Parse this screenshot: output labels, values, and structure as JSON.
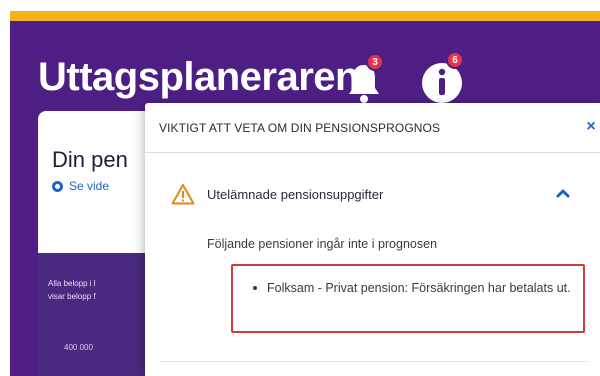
{
  "header": {
    "title": "Uttagsplaneraren",
    "notifications_count": "3",
    "info_count": "6"
  },
  "background_card": {
    "title": "Din pen",
    "link_label": "Se vide",
    "sub_text_line1": "Alla belopp i l",
    "sub_text_line2": "visar belopp f",
    "sub_amount": "400 000"
  },
  "popover": {
    "title": "VIKTIGT ATT VETA OM DIN PENSIONSPROGNOS",
    "close_label": "×",
    "accordion": {
      "label": "Utelämnade pensionsuppgifter",
      "expanded": true,
      "intro": "Följande pensioner ingår inte i prognosen",
      "items": [
        "Folksam - Privat pension: Försäkringen har betalats ut."
      ]
    }
  },
  "colors": {
    "brand_purple": "#4d1f84",
    "accent_yellow": "#f5b41e",
    "badge_red": "#e8324a",
    "link_blue": "#1e63c9",
    "warning_orange": "#e08a1a",
    "highlight_red": "#d9383a"
  },
  "icons": {
    "bell": "bell-icon",
    "info": "info-icon",
    "warning": "warning-icon",
    "chevron": "chevron-up-icon",
    "close": "close-icon"
  }
}
